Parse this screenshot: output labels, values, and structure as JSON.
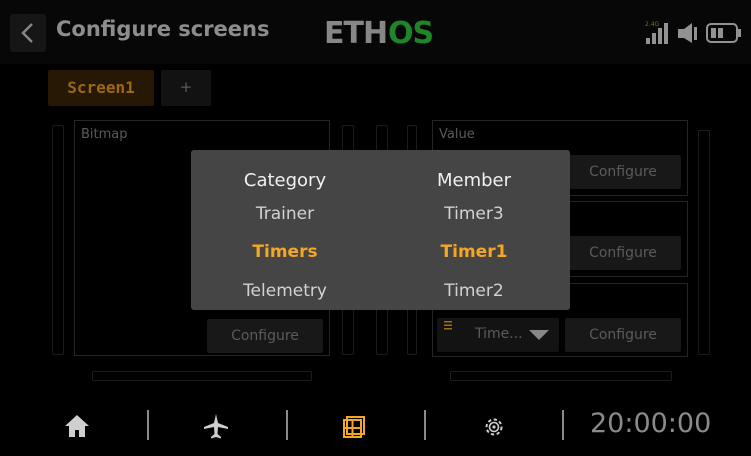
{
  "header": {
    "title": "Configure screens",
    "logo_text": "ETHOS",
    "radio_band": "2.4G"
  },
  "tabs": [
    {
      "label": "Screen1",
      "active": true
    },
    {
      "label": "+",
      "active": false
    }
  ],
  "layout": {
    "left_widget_label": "Bitmap",
    "left_configure_label": "Configure",
    "right_widgets": [
      {
        "label": "Value",
        "configure_label": "Configure"
      },
      {
        "label": "",
        "configure_label": "Configure"
      },
      {
        "label": "",
        "configure_label": "Configure",
        "source_value": "Time..."
      }
    ]
  },
  "picker": {
    "category_header": "Category",
    "member_header": "Member",
    "category_options": [
      "Trainer",
      "Timers",
      "Telemetry"
    ],
    "member_options": [
      "Timer3",
      "Timer1",
      "Timer2"
    ],
    "selected_category": "Timers",
    "selected_member": "Timer1"
  },
  "bottom_nav": {
    "items": [
      "home-icon",
      "airplane-icon",
      "screens-icon",
      "settings-icon"
    ],
    "active": "screens-icon",
    "clock": "20:00:00"
  },
  "colors": {
    "accent": "#f5a623",
    "logo_green": "#2ecc40",
    "background": "#000000",
    "modal": "#454545"
  }
}
